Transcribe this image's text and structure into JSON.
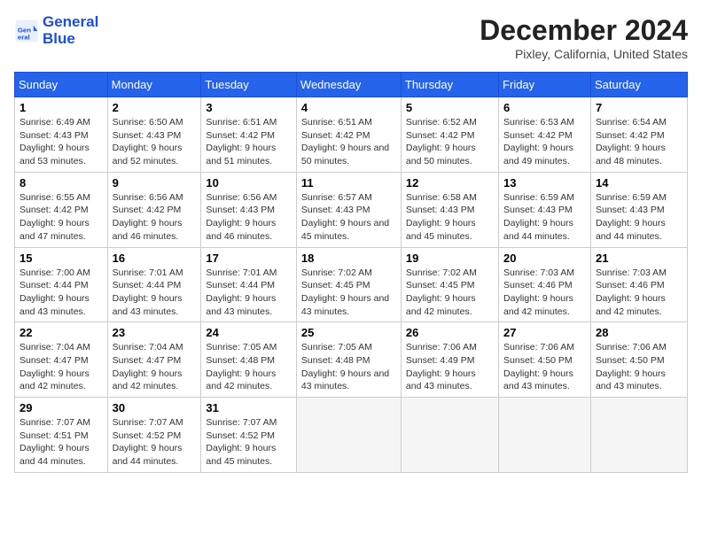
{
  "header": {
    "logo_line1": "General",
    "logo_line2": "Blue",
    "month": "December 2024",
    "location": "Pixley, California, United States"
  },
  "days_of_week": [
    "Sunday",
    "Monday",
    "Tuesday",
    "Wednesday",
    "Thursday",
    "Friday",
    "Saturday"
  ],
  "weeks": [
    [
      {
        "day": 1,
        "sunrise": "6:49 AM",
        "sunset": "4:43 PM",
        "daylight": "9 hours and 53 minutes."
      },
      {
        "day": 2,
        "sunrise": "6:50 AM",
        "sunset": "4:43 PM",
        "daylight": "9 hours and 52 minutes."
      },
      {
        "day": 3,
        "sunrise": "6:51 AM",
        "sunset": "4:42 PM",
        "daylight": "9 hours and 51 minutes."
      },
      {
        "day": 4,
        "sunrise": "6:51 AM",
        "sunset": "4:42 PM",
        "daylight": "9 hours and 50 minutes."
      },
      {
        "day": 5,
        "sunrise": "6:52 AM",
        "sunset": "4:42 PM",
        "daylight": "9 hours and 50 minutes."
      },
      {
        "day": 6,
        "sunrise": "6:53 AM",
        "sunset": "4:42 PM",
        "daylight": "9 hours and 49 minutes."
      },
      {
        "day": 7,
        "sunrise": "6:54 AM",
        "sunset": "4:42 PM",
        "daylight": "9 hours and 48 minutes."
      }
    ],
    [
      {
        "day": 8,
        "sunrise": "6:55 AM",
        "sunset": "4:42 PM",
        "daylight": "9 hours and 47 minutes."
      },
      {
        "day": 9,
        "sunrise": "6:56 AM",
        "sunset": "4:42 PM",
        "daylight": "9 hours and 46 minutes."
      },
      {
        "day": 10,
        "sunrise": "6:56 AM",
        "sunset": "4:43 PM",
        "daylight": "9 hours and 46 minutes."
      },
      {
        "day": 11,
        "sunrise": "6:57 AM",
        "sunset": "4:43 PM",
        "daylight": "9 hours and 45 minutes."
      },
      {
        "day": 12,
        "sunrise": "6:58 AM",
        "sunset": "4:43 PM",
        "daylight": "9 hours and 45 minutes."
      },
      {
        "day": 13,
        "sunrise": "6:59 AM",
        "sunset": "4:43 PM",
        "daylight": "9 hours and 44 minutes."
      },
      {
        "day": 14,
        "sunrise": "6:59 AM",
        "sunset": "4:43 PM",
        "daylight": "9 hours and 44 minutes."
      }
    ],
    [
      {
        "day": 15,
        "sunrise": "7:00 AM",
        "sunset": "4:44 PM",
        "daylight": "9 hours and 43 minutes."
      },
      {
        "day": 16,
        "sunrise": "7:01 AM",
        "sunset": "4:44 PM",
        "daylight": "9 hours and 43 minutes."
      },
      {
        "day": 17,
        "sunrise": "7:01 AM",
        "sunset": "4:44 PM",
        "daylight": "9 hours and 43 minutes."
      },
      {
        "day": 18,
        "sunrise": "7:02 AM",
        "sunset": "4:45 PM",
        "daylight": "9 hours and 43 minutes."
      },
      {
        "day": 19,
        "sunrise": "7:02 AM",
        "sunset": "4:45 PM",
        "daylight": "9 hours and 42 minutes."
      },
      {
        "day": 20,
        "sunrise": "7:03 AM",
        "sunset": "4:46 PM",
        "daylight": "9 hours and 42 minutes."
      },
      {
        "day": 21,
        "sunrise": "7:03 AM",
        "sunset": "4:46 PM",
        "daylight": "9 hours and 42 minutes."
      }
    ],
    [
      {
        "day": 22,
        "sunrise": "7:04 AM",
        "sunset": "4:47 PM",
        "daylight": "9 hours and 42 minutes."
      },
      {
        "day": 23,
        "sunrise": "7:04 AM",
        "sunset": "4:47 PM",
        "daylight": "9 hours and 42 minutes."
      },
      {
        "day": 24,
        "sunrise": "7:05 AM",
        "sunset": "4:48 PM",
        "daylight": "9 hours and 42 minutes."
      },
      {
        "day": 25,
        "sunrise": "7:05 AM",
        "sunset": "4:48 PM",
        "daylight": "9 hours and 43 minutes."
      },
      {
        "day": 26,
        "sunrise": "7:06 AM",
        "sunset": "4:49 PM",
        "daylight": "9 hours and 43 minutes."
      },
      {
        "day": 27,
        "sunrise": "7:06 AM",
        "sunset": "4:50 PM",
        "daylight": "9 hours and 43 minutes."
      },
      {
        "day": 28,
        "sunrise": "7:06 AM",
        "sunset": "4:50 PM",
        "daylight": "9 hours and 43 minutes."
      }
    ],
    [
      {
        "day": 29,
        "sunrise": "7:07 AM",
        "sunset": "4:51 PM",
        "daylight": "9 hours and 44 minutes."
      },
      {
        "day": 30,
        "sunrise": "7:07 AM",
        "sunset": "4:52 PM",
        "daylight": "9 hours and 44 minutes."
      },
      {
        "day": 31,
        "sunrise": "7:07 AM",
        "sunset": "4:52 PM",
        "daylight": "9 hours and 45 minutes."
      },
      null,
      null,
      null,
      null
    ]
  ]
}
